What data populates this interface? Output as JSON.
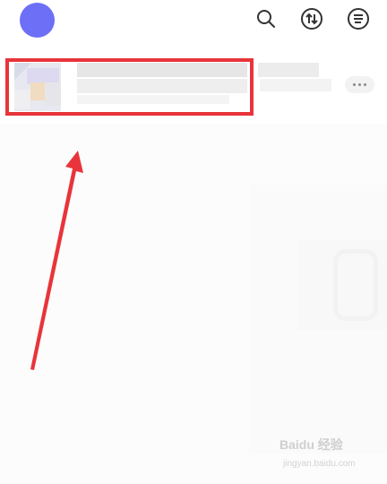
{
  "topbar": {
    "avatar_color": "#6d6ff7",
    "icons": [
      "search-icon",
      "sync-icon",
      "menu-icon"
    ]
  },
  "list": {
    "item": {
      "thumbnail": "blurred-image",
      "title": "",
      "more_label": "•••"
    }
  },
  "annotation": {
    "highlight_color": "#e8343a",
    "arrow_color": "#e8343a"
  },
  "watermark": {
    "logo_text": "Baidu 经验",
    "url": "jingyan.baidu.com"
  }
}
